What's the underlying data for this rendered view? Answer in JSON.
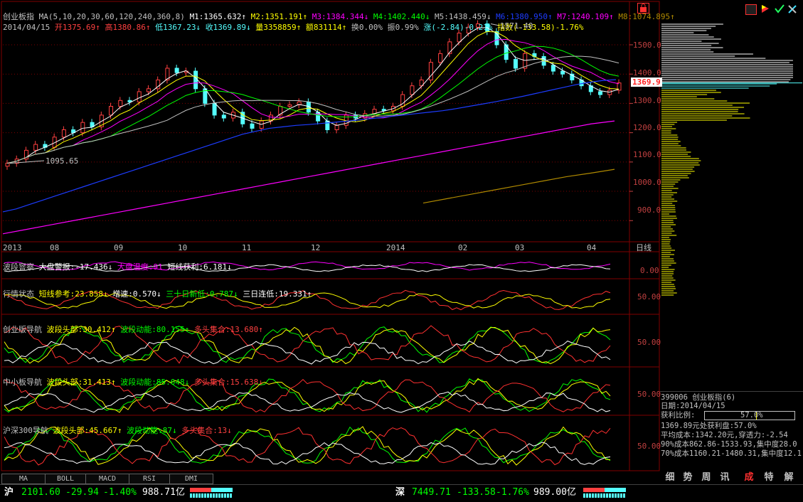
{
  "header": {
    "name": "创业板指",
    "ma_label": "MA(5,10,20,30,60,120,240,360,8)",
    "m1": "M1:1365.632↑",
    "m2": "M2:1351.191↑",
    "m3": "M3:1384.344↓",
    "m4": "M4:1402.440↓",
    "m5": "M5:1438.459↓",
    "m6": "M6:1380.950↑",
    "m7": "M7:1240.109↑",
    "m8": "M8:1074.895↑",
    "date": "2014/04/15",
    "open": "开1375.69↑",
    "high": "高1380.86↑",
    "low": "低1367.23↓",
    "close": "收1369.89↓",
    "volume": "量3358859↑",
    "amount": "额831114↑",
    "turnover": "换0.00%",
    "amplitude": "振0.99%",
    "change": "涨(-2.84)-0.21%",
    "index_pts": "指数(-133.58)-1.76%"
  },
  "colors": {
    "up": "#ff4040",
    "down": "#54ffff",
    "m1": "#ffffff",
    "m2": "#ffff00",
    "m3": "#ff00ff",
    "m4": "#00ff00",
    "m5": "#c0c0c0",
    "m6": "#1d3cff",
    "m7": "#ff00ff",
    "m8": "#b08a00",
    "grid": "#800000"
  },
  "annotations": {
    "high_mark": "1571.40",
    "low_mark": "1095.65",
    "current_price": "1369.9"
  },
  "price_axis": [
    "1500.0",
    "1400.0",
    "1300.0",
    "1200.0",
    "1100.0",
    "1000.0",
    "900.0"
  ],
  "date_axis": {
    "labels": [
      "2013",
      "08",
      "09",
      "10",
      "11",
      "12",
      "2014",
      "02",
      "03",
      "04"
    ],
    "period": "日线"
  },
  "chart_data": {
    "type": "candlestick",
    "title": "创业板指",
    "ylim": [
      840,
      1580
    ],
    "x_start": "2013",
    "x_end": "2014/04/15",
    "series": [
      {
        "name": "close",
        "values": [
          1095.65,
          1110,
          1140,
          1160,
          1150,
          1185,
          1210,
          1200,
          1235,
          1220,
          1260,
          1290,
          1310,
          1305,
          1340,
          1350,
          1380,
          1420,
          1405,
          1410,
          1350,
          1300,
          1260,
          1250,
          1270,
          1230,
          1215,
          1240,
          1260,
          1290,
          1295,
          1305,
          1270,
          1240,
          1210,
          1225,
          1260,
          1250,
          1265,
          1280,
          1275,
          1290,
          1330,
          1360,
          1380,
          1440,
          1470,
          1510,
          1540,
          1560,
          1571.4,
          1545,
          1500,
          1450,
          1420,
          1470,
          1460,
          1430,
          1410,
          1400,
          1380,
          1360,
          1340,
          1330,
          1345,
          1369.89
        ]
      },
      {
        "name": "M6",
        "values": [
          930,
          940,
          955,
          970,
          985,
          1000,
          1015,
          1030,
          1045,
          1060,
          1075,
          1090,
          1105,
          1120,
          1135,
          1150,
          1165,
          1180,
          1195,
          1205,
          1215,
          1220,
          1225,
          1228,
          1232,
          1236,
          1240,
          1245,
          1250,
          1255,
          1260,
          1265,
          1270,
          1275,
          1282,
          1290,
          1298,
          1306,
          1315,
          1324,
          1334,
          1344,
          1354,
          1364,
          1372,
          1378,
          1381
        ]
      },
      {
        "name": "M7",
        "values": [
          855,
          870,
          885,
          900,
          915,
          930,
          945,
          960,
          975,
          990,
          1005,
          1020,
          1035,
          1050,
          1065,
          1080,
          1095,
          1110,
          1125,
          1140,
          1155,
          1170,
          1185,
          1200,
          1215,
          1230,
          1240
        ]
      },
      {
        "name": "M8",
        "values": [
          960,
          975,
          990,
          1005,
          1020,
          1035,
          1050,
          1062,
          1075
        ]
      }
    ]
  },
  "indicators": [
    {
      "title": "波段窨察",
      "parts": [
        "大盘警报:-17.436↓",
        "大盘温度:91",
        "短线获利:6.181↓"
      ],
      "axis": "0.00"
    },
    {
      "title": "行情状态",
      "parts": [
        "短线参考:23.858↓",
        "增速:0.570↓",
        "三十日新低:0.787↓",
        "三日连低:19.331↑"
      ],
      "axis": "50.00"
    },
    {
      "title": "创业版导航",
      "parts": [
        "波段头部:30.412↑",
        "波段动能:80.155↑",
        "多头集合:13.680↑"
      ],
      "axis": "50.00"
    },
    {
      "title": "中小板导航",
      "parts": [
        "波段头部:31.413↑",
        "波段动能:85.048↓",
        "多头集合:15.638↓"
      ],
      "axis": "50.00"
    },
    {
      "title": "沪深300导航",
      "parts": [
        "波段头部:45.667↑",
        "波段动能:87↓",
        "多头集合:13↓"
      ],
      "axis": "50.00"
    }
  ],
  "bottom_tabs": [
    "MA",
    "BOLL",
    "MACD",
    "RSI",
    "DMI"
  ],
  "info_panel": {
    "code_name": "399006 创业板指(6)",
    "date": "日期:2014/04/15",
    "profit_ratio_label": "获利比例:",
    "profit_ratio": "57.0%",
    "profit_ratio_value": 0.57,
    "line1": "1369.89元处获利盘:57.0%",
    "line2": "平均成本:1342.20元,穿透力:-2.54",
    "line3": "90%成本862.86-1533.93,集中度28.0",
    "line4": "70%成本1160.21-1480.31,集中度12.1"
  },
  "panel_tabs": [
    "细",
    "势",
    "周",
    "讯",
    "成",
    "特",
    "解"
  ],
  "status_bar": {
    "sh_label": "沪",
    "sh_index": "2101.60",
    "sh_change": "-29.94",
    "sh_pct": "-1.40%",
    "sh_amount": "988.71亿",
    "sz_label": "深",
    "sz_index": "7449.71",
    "sz_change": "-133.58",
    "sz_pct": "-1.76%",
    "sz_amount": "989.00亿"
  }
}
